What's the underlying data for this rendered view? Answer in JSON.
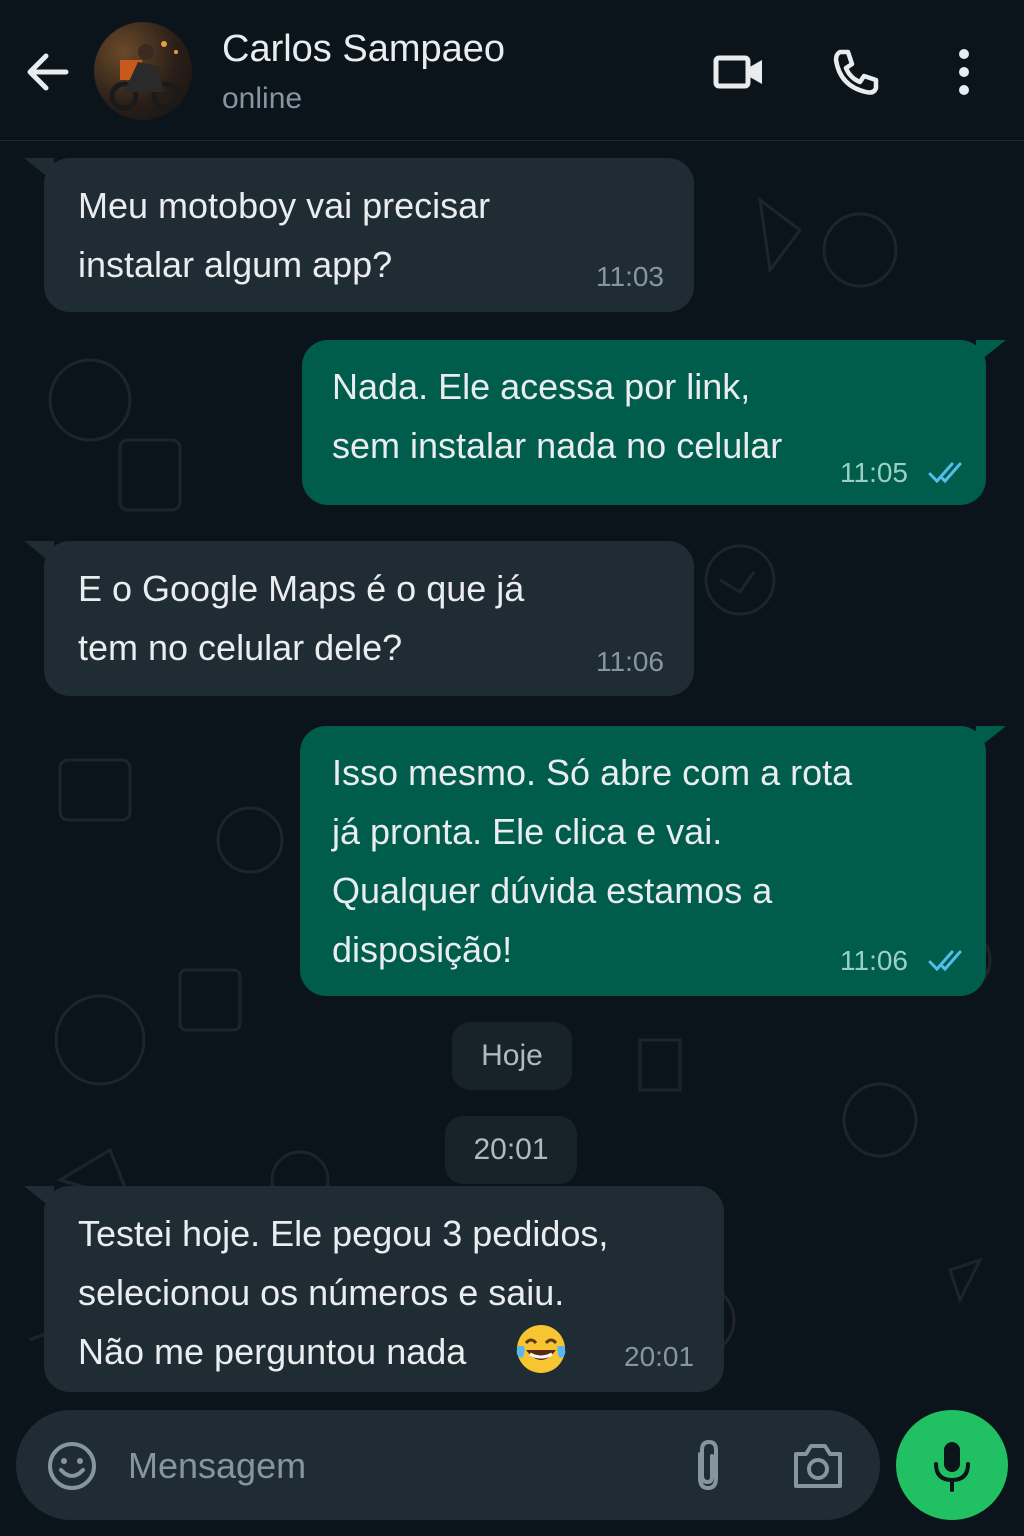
{
  "header": {
    "contact_name": "Carlos Sampaeo",
    "status": "online",
    "icons": [
      "back-arrow-icon",
      "video-call-icon",
      "voice-call-icon",
      "more-options-icon"
    ]
  },
  "messages": [
    {
      "direction": "incoming",
      "lines": [
        "Meu motoboy vai precisar",
        "instalar algum app?"
      ],
      "time": "11:03"
    },
    {
      "direction": "outgoing",
      "lines": [
        "Nada. Ele acessa por link,",
        "sem instalar nada no celular"
      ],
      "time": "11:05",
      "read": true
    },
    {
      "direction": "incoming",
      "lines": [
        "E o Google Maps é o que já",
        "tem no celular dele?"
      ],
      "time": "11:06"
    },
    {
      "direction": "outgoing",
      "lines": [
        "Isso mesmo. Só abre com a rota",
        "já pronta. Ele clica e vai.",
        "Qualquer dúvida estamos a",
        "disposição!"
      ],
      "time": "11:06",
      "read": true
    },
    {
      "direction": "incoming",
      "lines": [
        "Testei hoje. Ele pegou 3 pedidos,",
        "selecionou os números e saiu.",
        "Não me perguntou nada"
      ],
      "time": "20:01",
      "emoji": "tears-of-joy-emoji"
    }
  ],
  "dividers": {
    "day": "Hoje",
    "time": "20:01"
  },
  "composer": {
    "placeholder": "Mensagem",
    "icons": [
      "emoji-icon",
      "attach-icon",
      "camera-icon",
      "mic-icon"
    ]
  },
  "colors": {
    "background": "#0b141a",
    "incoming_bubble": "#202c33",
    "outgoing_bubble": "#005c4b",
    "read_ticks": "#53bdeb",
    "mic_button": "#21c063"
  }
}
